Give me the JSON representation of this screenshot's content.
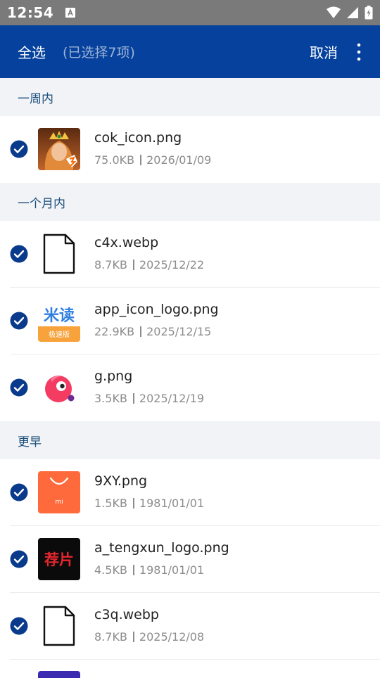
{
  "status_bar": {
    "time": "12:54"
  },
  "toolbar": {
    "select_all_label": "全选",
    "selection_count": "(已选择7项)",
    "cancel_label": "取消"
  },
  "sections": [
    {
      "header": "一周内"
    },
    {
      "header": "一个月内"
    },
    {
      "header": "更早"
    }
  ],
  "files": [
    {
      "name": "cok_icon.png",
      "size": "75.0KB",
      "date": "2026/01/09",
      "checked": true,
      "icon": "game-character-icon"
    },
    {
      "name": "c4x.webp",
      "size": "8.7KB",
      "date": "2025/12/22",
      "checked": true,
      "icon": "generic-file-icon"
    },
    {
      "name": "app_icon_logo.png",
      "size": "22.9KB",
      "date": "2025/12/15",
      "checked": true,
      "icon": "midu-app-icon",
      "icon_text": "米读",
      "icon_subtext": "极速版"
    },
    {
      "name": "g.png",
      "size": "3.5KB",
      "date": "2025/12/19",
      "checked": true,
      "icon": "pink-bird-icon"
    },
    {
      "name": "9XY.png",
      "size": "1.5KB",
      "date": "1981/01/01",
      "checked": true,
      "icon": "mi-shopping-bag-icon",
      "icon_text": "mi"
    },
    {
      "name": "a_tengxun_logo.png",
      "size": "4.5KB",
      "date": "1981/01/01",
      "checked": true,
      "icon": "tengxun-video-icon",
      "icon_text": "荐片"
    },
    {
      "name": "c3q.webp",
      "size": "8.7KB",
      "date": "2025/12/08",
      "checked": true,
      "icon": "generic-file-icon"
    }
  ],
  "colors": {
    "toolbar_bg": "#06429d",
    "check_blue": "#0a3a8c",
    "section_bg": "#f1f3f7",
    "status_bar_bg": "#7a7a7a"
  }
}
